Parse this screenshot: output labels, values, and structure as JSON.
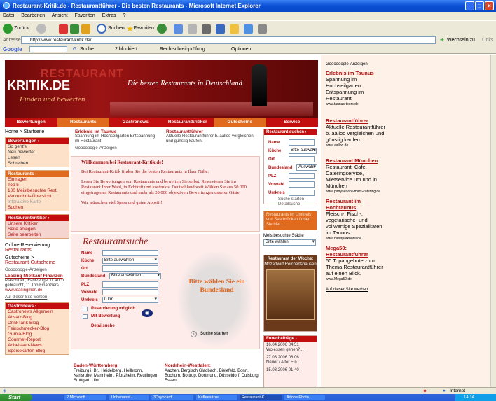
{
  "window": {
    "title": "Restaurant-Kritik.de - Restaurantführer - Die besten Restaurants - Microsoft Internet Explorer",
    "colors": {
      "titlebar": "#0a4fd4",
      "accent_red": "#c20e0e",
      "accent_orange": "#e06a1e"
    }
  },
  "menubar": {
    "items": [
      "Datei",
      "Bearbeiten",
      "Ansicht",
      "Favoriten",
      "Extras",
      "?"
    ]
  },
  "toolbar": {
    "back": "Zurück",
    "search": "Suchen",
    "favorites": "Favoriten"
  },
  "addressbar": {
    "label": "Adresse",
    "url": "http://www.restaurant-kritik.de/",
    "go": "Wechseln zu",
    "links": "Links"
  },
  "googlebar": {
    "brand": "Google",
    "search": "Suche",
    "blocked": "2 blockiert",
    "spell": "Rechtschreibprüfung",
    "options": "Optionen"
  },
  "banner": {
    "logo_top": "RESTAURANT",
    "logo_main": "KRITIK.DE",
    "logo_sub": "Finden und bewerten",
    "slogan": "Die besten Restaurants in Deutschland"
  },
  "nav": [
    "Bewertungen",
    "Restaurants",
    "Gastronews",
    "Restaurantkritiker",
    "Gutscheine",
    "Service"
  ],
  "left": {
    "home": "Home > Startseite",
    "box1": {
      "title": "Bewertungen ›",
      "items": [
        "So geht's",
        "Neu bewertet",
        "Lesen",
        "Schreiben"
      ]
    },
    "box2": {
      "title": "Restaurants ›",
      "items": [
        "Eintragen",
        "Top 5",
        "100 Meistbesuchte Rest.",
        "Verzeichnis/Übersicht",
        "Interaktive Karte",
        "Suchen"
      ]
    },
    "box3": {
      "title": "Restaurantkritiker ›",
      "items": [
        "Unsere Kritiker",
        "Seite anlegen",
        "Seite bearbeiten"
      ]
    },
    "online1": "Online-Reservierung",
    "online2": "Restaurants",
    "gutscheine1": "Gutscheine >",
    "gutscheine2": "Restaurant-Gutscheine",
    "ads_label": "Goooooogle-Anzeigen",
    "ad_title": "Leasing Mietkauf Finanzen",
    "ad_text": "Maschinen, Fahrzeuge, IT auch gebraucht, 11 Top Finanziers",
    "ad_url": "www.leasingman.de",
    "ad_link": "Auf dieser Site werben",
    "box4": {
      "title": "Gastronews ›",
      "items": [
        "Gastronews Allgemein",
        "Absatz-Blog",
        "DrinkTank-Blog",
        "Feinschmecker-Blog",
        "Gumia-Blog",
        "Gourmet-Report",
        "Anbeissen-News",
        "Speisekarten-Blog"
      ]
    }
  },
  "mid": {
    "ad1": {
      "title": "Erlebnis im Taunus",
      "text": "Spannung im Hochseilgarten Entspannung im Restaurant"
    },
    "ad2": {
      "title": "Restaurantführer",
      "text": "Aktuelle Restaurantführer b. aalloo vergleichen und günstig kaufen."
    },
    "ads_label": "Goooooogle-Anzeigen",
    "welcome_title": "Willkommen bei Restaurant-Kritik.de!",
    "welcome_p1": "Bei Restaurant-Kritik finden Sie die besten Restaurants in Ihrer Nähe.",
    "welcome_p2": "Lesen Sie Bewertungen von Restaurants und bewerten Sie selbst. Reservieren Sie im Restaurant Ihrer Wahl, in Echtzeit und kostenlos. Deutschland weit Wählen Sie aus 50.000 eingetragenen Restaurants und mehr als 20.000 objektiven Bewertungen unserer Gäste.",
    "welcome_p3": "Wir wünschen viel Spass und guten Appetit!",
    "search_title": "Restaurantsuche",
    "labels": [
      "Name",
      "Küche",
      "Ort",
      "Bundesland",
      "PLZ",
      "Vorwahl",
      "Umkreis"
    ],
    "kueche_value": "Bitte auswählen",
    "bundesland_value": "Bitte auswählen",
    "umkreis_value": "0 km",
    "chk1": "Reservierung möglich",
    "chk2": "Mit Bewertung",
    "detail": "Detailsuche",
    "start": "Suche starten",
    "map_text": "Bitte wählen Sie ein Bundesland",
    "region1_title": "Baden-Württemberg:",
    "region1_text": "Freiburg i. Br., Heidelberg, Heilbronn, Karlsruhe, Mannheim, Pforzheim, Reutlingen, Stuttgart, Ulm...",
    "region2_title": "Nordrhein-Westfalen:",
    "region2_text": "Aachen, Bergisch Gladbach, Bielefeld, Bonn, Bochum, Bottrop, Dortmund, Düsseldorf, Duisburg, Essen..."
  },
  "right": {
    "search_title": "Restaurant suchen ›",
    "labels": [
      "Name",
      "Küche",
      "Ort",
      "Bundesland",
      "PLZ",
      "Vorwahl",
      "Umkreis"
    ],
    "kueche_value": "Bitte auswähl",
    "bundesland_value": "Auswähl",
    "start": "Suche starten",
    "detail": "Detailsuche",
    "umkreis_box": "Restaurants im Umkreis von Saarbrücken finden Sie hier...",
    "cities_label": "Meistbesuchte Städte",
    "cities_value": "Bitte wählen",
    "week_title": "Restaurant der Woche:",
    "week_name": "Mozartwirt Reichertshausen",
    "forum_title": "Forenbeiträge ›",
    "forum1_date": "16.04.2006 04:51",
    "forum1_text": "Wo essen gehen?...",
    "forum2_date": "27.03.2006 06:06",
    "forum2_text": "Neuer / Alter Ein...",
    "forum3_date": "15.03.2006 01:40"
  },
  "ads": {
    "label": "Goooooogle-Anzeigen",
    "a1_title": "Erlebnis im Taunus",
    "a1_text": "Spannung im Hochseilgarten Entspannung im Restaurant",
    "a1_url": "www.taunus-tours.de",
    "a2_title": "Restaurantführer",
    "a2_text": "Aktuelle Restaurantführer b. aalloo vergleichen und günstig kaufen.",
    "a2_url": "www.aalloo.de",
    "a3_title": "Restaurant München",
    "a3_text": "Restaurant, Cafe, Cateringservice, Mietservice um und in München",
    "a3_url": "www.partyservice-mars-catering.de",
    "a4_title": "Restaurant im Hochtaunus",
    "a4_text": "Fleisch-, Fisch-, vegetarische- und vollwertige Spezialitäten im Taunus",
    "a4_url": "www.naturparkhotel.de",
    "a5_title": "Mega50: Restaurantführer",
    "a5_text": "50 Topangebote zum Thema Restaurantführer auf einen Blick.",
    "a5_url": "www.Mega50.de",
    "a_link": "Auf dieser Site werben"
  },
  "status": {
    "zone": "Internet"
  },
  "taskbar": {
    "start": "Start",
    "tasks": [
      "2 Microsoft ...",
      "Unbenannt - ...",
      "3Dsybcard...",
      "Kaffeesätze ...",
      "Restaurant-K...",
      "Adobe Photo..."
    ],
    "clock": "14:14"
  }
}
